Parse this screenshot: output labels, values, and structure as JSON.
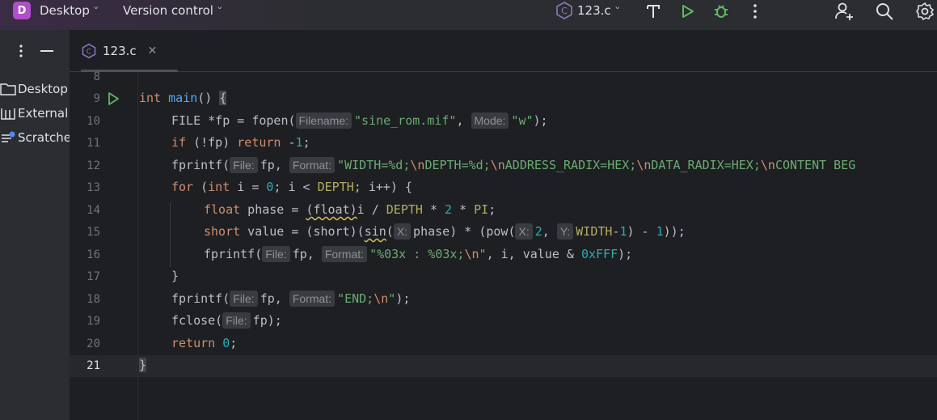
{
  "titlebar": {
    "project_badge": "D",
    "project_name": "Desktop",
    "vcs_label": "Version control",
    "run_config": "123.c",
    "icons": [
      "build-hammer-icon",
      "run-icon",
      "debug-icon",
      "more-icon",
      "add-user-icon",
      "search-icon",
      "settings-icon"
    ]
  },
  "sidebar": {
    "items": [
      {
        "label": "Desktop",
        "icon": "folder-icon"
      },
      {
        "label": "External",
        "icon": "library-icon"
      },
      {
        "label": "Scratche",
        "icon": "scratches-icon"
      }
    ]
  },
  "tab": {
    "label": "123.c",
    "icon": "c-file-icon"
  },
  "gutter": {
    "line_numbers": [
      "8",
      "9",
      "10",
      "11",
      "12",
      "13",
      "14",
      "15",
      "16",
      "17",
      "18",
      "19",
      "20",
      "21"
    ]
  },
  "code": {
    "l9_int": "int",
    "l9_main": "main",
    "l9_rest": "() ",
    "l9_brace": "{",
    "l10_a": "FILE *fp = fopen(",
    "l10_hint1": "Filename:",
    "l10_str1": "\"sine_rom.mif\"",
    "l10_comma": ", ",
    "l10_hint2": "Mode:",
    "l10_str2": "\"w\"",
    "l10_end": ");",
    "l11_if": "if",
    "l11_a": " (!fp) ",
    "l11_return": "return",
    "l11_b": " -",
    "l11_num": "1",
    "l11_end": ";",
    "l12_a": "fprintf(",
    "l12_hint1": "File:",
    "l12_b": "fp, ",
    "l12_hint2": "Format:",
    "l12_s1": "\"WIDTH=%d;",
    "l12_e1": "\\n",
    "l12_s2": "DEPTH=%d;",
    "l12_e2": "\\n",
    "l12_s3": "ADDRESS_RADIX=HEX;",
    "l12_e3": "\\n",
    "l12_s4": "DATA_RADIX=HEX;",
    "l12_e4": "\\n",
    "l12_s5": "CONTENT BEG",
    "l13_for": "for",
    "l13_a": " (",
    "l13_int": "int",
    "l13_b": " i = ",
    "l13_zero": "0",
    "l13_c": "; i < ",
    "l13_depth": "DEPTH",
    "l13_d": "; i++) {",
    "l14_float": "float",
    "l14_a": " phase = ",
    "l14_cast": "(float)",
    "l14_b": "i / ",
    "l14_depth": "DEPTH",
    "l14_c": " * ",
    "l14_two": "2",
    "l14_d": " * ",
    "l14_pi": "PI",
    "l14_end": ";",
    "l15_short": "short",
    "l15_a": " value = (short)(",
    "l15_sin": "sin",
    "l15_b": "(",
    "l15_hintx": "X:",
    "l15_c": "phase) * (pow(",
    "l15_hintx2": "X:",
    "l15_two": "2",
    "l15_d": ", ",
    "l15_hinty": "Y:",
    "l15_width": "WIDTH",
    "l15_e": "-",
    "l15_one": "1",
    "l15_f": ") - ",
    "l15_one2": "1",
    "l15_g": "));",
    "l16_a": "fprintf(",
    "l16_hint1": "File:",
    "l16_b": "fp, ",
    "l16_hint2": "Format:",
    "l16_s1": "\"%03x : %03x;",
    "l16_e1": "\\n",
    "l16_s2": "\"",
    "l16_c": ", i, value & ",
    "l16_hex": "0xFFF",
    "l16_end": ");",
    "l17": "}",
    "l18_a": "fprintf(",
    "l18_hint1": "File:",
    "l18_b": "fp, ",
    "l18_hint2": "Format:",
    "l18_s1": "\"END;",
    "l18_e1": "\\n",
    "l18_s2": "\"",
    "l18_end": ");",
    "l19_a": "fclose(",
    "l19_hint": "File:",
    "l19_b": "fp);",
    "l20_return": "return",
    "l20_a": " ",
    "l20_zero": "0",
    "l20_end": ";",
    "l21": "}"
  },
  "colors": {
    "keyword": "#cf8e6d",
    "function": "#56a8f5",
    "string": "#6aab73",
    "number": "#2aacb8",
    "macro": "#b3ae60"
  }
}
